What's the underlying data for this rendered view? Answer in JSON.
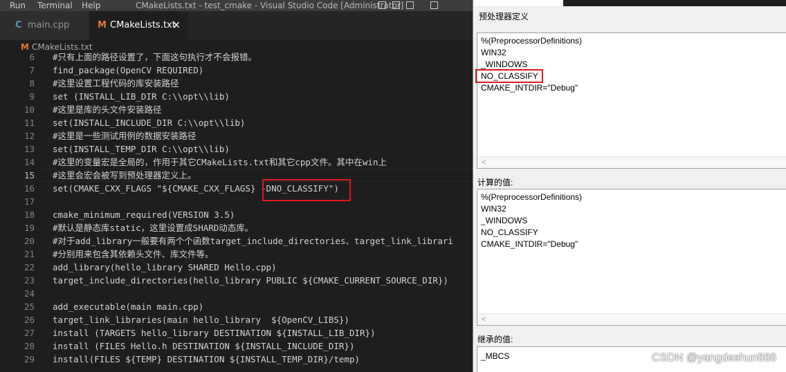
{
  "vscode": {
    "menu": [
      "Run",
      "Terminal",
      "Help"
    ],
    "window_title": "CMakeLists.txt - test_cmake - Visual Studio Code [Administrator]",
    "tabs": [
      {
        "label": "main.cpp",
        "icon": "cpp-icon",
        "icon_glyph": "C",
        "icon_color": "#519aba",
        "active": false
      },
      {
        "label": "CMakeLists.txt",
        "icon": "cmake-icon",
        "icon_glyph": "M",
        "icon_color": "#e37933",
        "active": true,
        "close": "✕"
      }
    ],
    "breadcrumb": {
      "icon": "M",
      "text": "CMakeLists.txt"
    },
    "current_line": 15,
    "lines": [
      {
        "n": "6",
        "code": "#只有上面的路径设置了，下面这句执行才不会报错。"
      },
      {
        "n": "7",
        "code": "find_package(OpenCV REQUIRED)"
      },
      {
        "n": "8",
        "code": "#这里设置工程代码的库安装路径"
      },
      {
        "n": "9",
        "code": "set (INSTALL_LIB_DIR C:\\\\opt\\\\lib)"
      },
      {
        "n": "10",
        "code": "#这里是库的头文件安装路径"
      },
      {
        "n": "11",
        "code": "set(INSTALL_INCLUDE_DIR C:\\\\opt\\\\lib)"
      },
      {
        "n": "12",
        "code": "#这里是一些测试用例的数据安装路径"
      },
      {
        "n": "13",
        "code": "set(INSTALL_TEMP_DIR C:\\\\opt\\\\lib)"
      },
      {
        "n": "14",
        "code": "#这里的变量宏是全局的，作用于其它CMakeLists.txt和其它cpp文件。其中在win上"
      },
      {
        "n": "15",
        "code": "#这里会宏会被写到预处理器定义上。"
      },
      {
        "n": "16",
        "code": "set(CMAKE_CXX_FLAGS \"${CMAKE_CXX_FLAGS} -DNO_CLASSIFY\")"
      },
      {
        "n": "17",
        "code": ""
      },
      {
        "n": "18",
        "code": "cmake_minimum_required(VERSION 3.5)"
      },
      {
        "n": "19",
        "code": "#默认是静态库static，这里设置成SHARD动态库。"
      },
      {
        "n": "20",
        "code": "#对于add_library一般要有两个个函数target_include_directories、target_link_librari"
      },
      {
        "n": "21",
        "code": "#分别用来包含其依赖头文件、库文件等。"
      },
      {
        "n": "22",
        "code": "add_library(hello_library SHARED Hello.cpp)"
      },
      {
        "n": "23",
        "code": "target_include_directories(hello_library PUBLIC ${CMAKE_CURRENT_SOURCE_DIR})"
      },
      {
        "n": "24",
        "code": ""
      },
      {
        "n": "25",
        "code": "add_executable(main main.cpp)"
      },
      {
        "n": "26",
        "code": "target_link_libraries(main hello_library  ${OpenCV_LIBS})"
      },
      {
        "n": "27",
        "code": "install (TARGETS hello_library DESTINATION ${INSTALL_LIB_DIR})"
      },
      {
        "n": "28",
        "code": "install (FILES Hello.h DESTINATION ${INSTALL_INCLUDE_DIR})"
      },
      {
        "n": "29",
        "code": "install(FILES ${TEMP} DESTINATION ${INSTALL_TEMP_DIR}/temp)"
      }
    ],
    "highlight_color": "#e0181d"
  },
  "dialog": {
    "title": "预处理器定义",
    "definitions": [
      "%(PreprocessorDefinitions)",
      "WIN32",
      "_WINDOWS",
      "NO_CLASSIFY",
      "CMAKE_INTDIR=\"Debug\""
    ],
    "evaluated_label": "计算的值:",
    "evaluated": [
      "%(PreprocessorDefinitions)",
      "WIN32",
      "_WINDOWS",
      "NO_CLASSIFY",
      "CMAKE_INTDIR=\"Debug\""
    ],
    "inherited_label": "继承的值:",
    "inherited": [
      "_MBCS"
    ],
    "scroll_left": "<"
  },
  "watermark": "CSDN @yangdeshun888"
}
